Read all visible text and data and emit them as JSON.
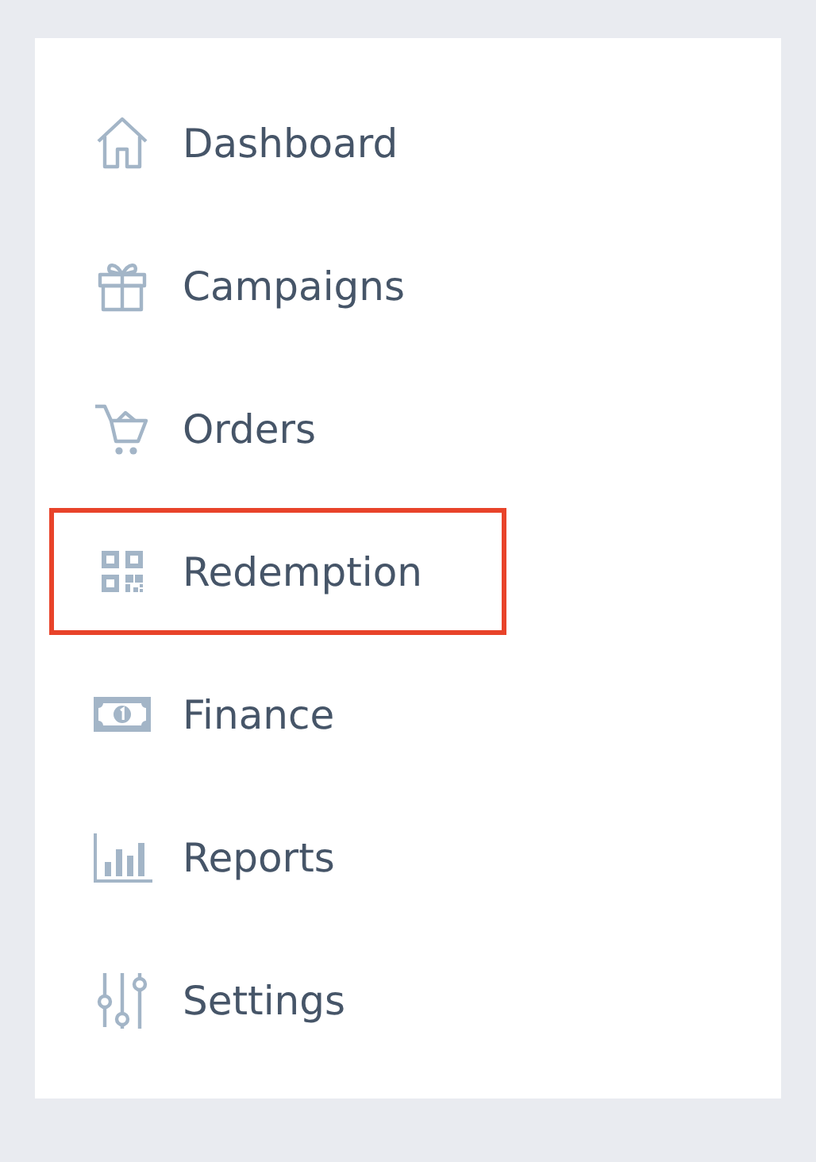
{
  "sidebar": {
    "items": [
      {
        "label": "Dashboard",
        "selected": false
      },
      {
        "label": "Campaigns",
        "selected": false
      },
      {
        "label": "Orders",
        "selected": false
      },
      {
        "label": "Redemption",
        "selected": true
      },
      {
        "label": "Finance",
        "selected": false
      },
      {
        "label": "Reports",
        "selected": false
      },
      {
        "label": "Settings",
        "selected": false
      }
    ]
  }
}
